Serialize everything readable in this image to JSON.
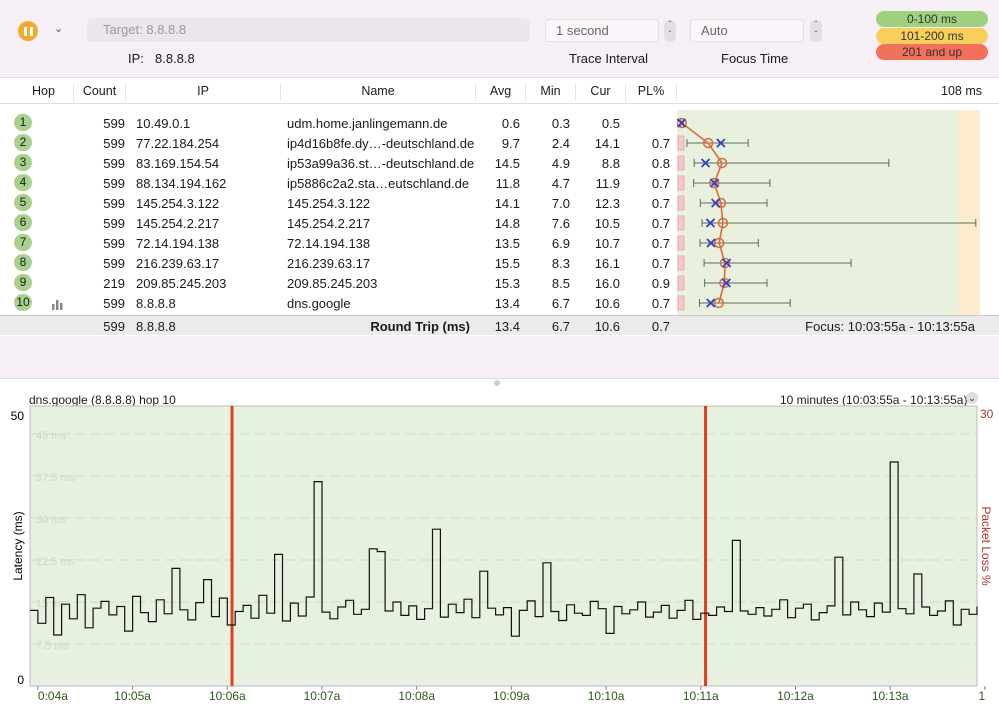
{
  "toolbar": {
    "target_placeholder": "Target:  8.8.8.8",
    "ip_label": "IP:",
    "ip_value": "8.8.8.8",
    "trace_interval_value": "1 second",
    "trace_interval_label": "Trace Interval",
    "focus_time_value": "Auto",
    "focus_time_label": "Focus Time",
    "play_state": "paused",
    "legend": [
      {
        "label": "0-100 ms",
        "color": "#9fd27f"
      },
      {
        "label": "101-200 ms",
        "color": "#f9cf5c"
      },
      {
        "label": "201 and up",
        "color": "#f2715a"
      }
    ]
  },
  "table": {
    "columns": [
      "Hop",
      "Count",
      "IP",
      "Name",
      "Avg",
      "Min",
      "Cur",
      "PL%"
    ],
    "graph_scale_label": "108 ms",
    "graph_scale_max_ms": 108,
    "rows": [
      {
        "hop": "1",
        "count": "599",
        "ip": "10.49.0.1",
        "name": "udm.home.janlingemann.de",
        "avg": "0.6",
        "min": "0.3",
        "cur": "0.5",
        "pl": "",
        "max_ms": 1.2
      },
      {
        "hop": "2",
        "count": "599",
        "ip": "77.22.184.254",
        "name": "ip4d16b8fe.dy…-deutschland.de",
        "avg": "9.7",
        "min": "2.4",
        "cur": "14.1",
        "pl": "0.7",
        "max_ms": 23.5
      },
      {
        "hop": "3",
        "count": "599",
        "ip": "83.169.154.54",
        "name": "ip53a99a36.st…-deutschland.de",
        "avg": "14.5",
        "min": "4.9",
        "cur": "8.8",
        "pl": "0.8",
        "max_ms": 72
      },
      {
        "hop": "4",
        "count": "599",
        "ip": "88.134.194.162",
        "name": "ip5886c2a2.sta…eutschland.de",
        "avg": "11.8",
        "min": "4.7",
        "cur": "11.9",
        "pl": "0.7",
        "max_ms": 31
      },
      {
        "hop": "5",
        "count": "599",
        "ip": "145.254.3.122",
        "name": "145.254.3.122",
        "avg": "14.1",
        "min": "7.0",
        "cur": "12.3",
        "pl": "0.7",
        "max_ms": 30
      },
      {
        "hop": "6",
        "count": "599",
        "ip": "145.254.2.217",
        "name": "145.254.2.217",
        "avg": "14.8",
        "min": "7.6",
        "cur": "10.5",
        "pl": "0.7",
        "max_ms": 102
      },
      {
        "hop": "7",
        "count": "599",
        "ip": "72.14.194.138",
        "name": "72.14.194.138",
        "avg": "13.5",
        "min": "6.9",
        "cur": "10.7",
        "pl": "0.7",
        "max_ms": 27
      },
      {
        "hop": "8",
        "count": "599",
        "ip": "216.239.63.17",
        "name": "216.239.63.17",
        "avg": "15.5",
        "min": "8.3",
        "cur": "16.1",
        "pl": "0.7",
        "max_ms": 59
      },
      {
        "hop": "9",
        "count": "219",
        "ip": "209.85.245.203",
        "name": "209.85.245.203",
        "avg": "15.3",
        "min": "8.5",
        "cur": "16.0",
        "pl": "0.9",
        "max_ms": 30
      },
      {
        "hop": "10",
        "count": "599",
        "ip": "8.8.8.8",
        "name": "dns.google",
        "avg": "13.4",
        "min": "6.7",
        "cur": "10.6",
        "pl": "0.7",
        "max_ms": 38,
        "selected": true
      }
    ],
    "summary": {
      "count": "599",
      "ip": "8.8.8.8",
      "label": "Round Trip (ms)",
      "avg": "13.4",
      "min": "6.7",
      "cur": "10.6",
      "pl": "0.7",
      "focus": "Focus: 10:03:55a - 10:13:55a"
    }
  },
  "chart_data": {
    "type": "line",
    "title": "dns.google (8.8.8.8) hop 10",
    "range_label": "10 minutes (10:03:55a - 10:13:55a)",
    "ylabel": "Latency (ms)",
    "y2label": "Packet Loss %",
    "ylim": [
      0,
      50
    ],
    "y2_max_label": "30",
    "y_tick_labels": [
      "0",
      "50"
    ],
    "grid_labels": [
      "45 ms",
      "37.5 ms",
      "30 ms",
      "22.5 ms",
      "15 ms",
      "7.5 ms"
    ],
    "grid_values": [
      45,
      37.5,
      30,
      22.5,
      15,
      7.5
    ],
    "x_tick_labels": [
      "0:04a",
      "10:05a",
      "10:06a",
      "10:07a",
      "10:08a",
      "10:09a",
      "10:10a",
      "10:11a",
      "10:12a",
      "10:13a",
      "1"
    ],
    "x_start": "10:03:55a",
    "x_end": "10:13:55a",
    "packet_loss_times": [
      "10:06:03a",
      "10:11:03a"
    ],
    "latency_ms": [
      13.5,
      11.2,
      15.8,
      9.1,
      14.6,
      12.0,
      16.3,
      10.4,
      13.9,
      15.1,
      12.7,
      14.2,
      9.8,
      16.0,
      13.1,
      11.5,
      15.4,
      12.9,
      21.0,
      13.6,
      11.8,
      14.9,
      19.0,
      12.4,
      15.7,
      10.9,
      13.3,
      14.4,
      12.1,
      16.2,
      13.0,
      23.5,
      11.6,
      14.8,
      12.5,
      15.9,
      36.5,
      13.2,
      12.0,
      14.1,
      15.3,
      12.8,
      13.7,
      24.5,
      24.0,
      13.4,
      15.0,
      12.6,
      14.3,
      11.9,
      13.8,
      28.0,
      12.3,
      14.6,
      13.1,
      15.5,
      12.2,
      20.5,
      13.9,
      12.7,
      14.0,
      8.9,
      13.5,
      15.2,
      12.4,
      22.0,
      13.3,
      11.7,
      14.5,
      13.0,
      12.6,
      15.1,
      13.8,
      9.4,
      14.2,
      12.9,
      13.6,
      15.0,
      12.3,
      13.2,
      14.4,
      12.1,
      13.5,
      15.3,
      11.9,
      13.0,
      12.6,
      14.1,
      13.3,
      26.0,
      13.4,
      12.8,
      14.0,
      12.5,
      13.7,
      15.4,
      12.2,
      13.9,
      14.6,
      11.8,
      13.1,
      14.3,
      23.0,
      12.7,
      15.0,
      13.6,
      12.4,
      14.8,
      13.2,
      40.0,
      13.8,
      12.9,
      20.0,
      14.1,
      12.6,
      13.4,
      15.2,
      10.9,
      13.7,
      12.8,
      14.2
    ],
    "line_color": "#111111",
    "plot_bg": "#e6f2df",
    "loss_color": "#e0401f"
  }
}
